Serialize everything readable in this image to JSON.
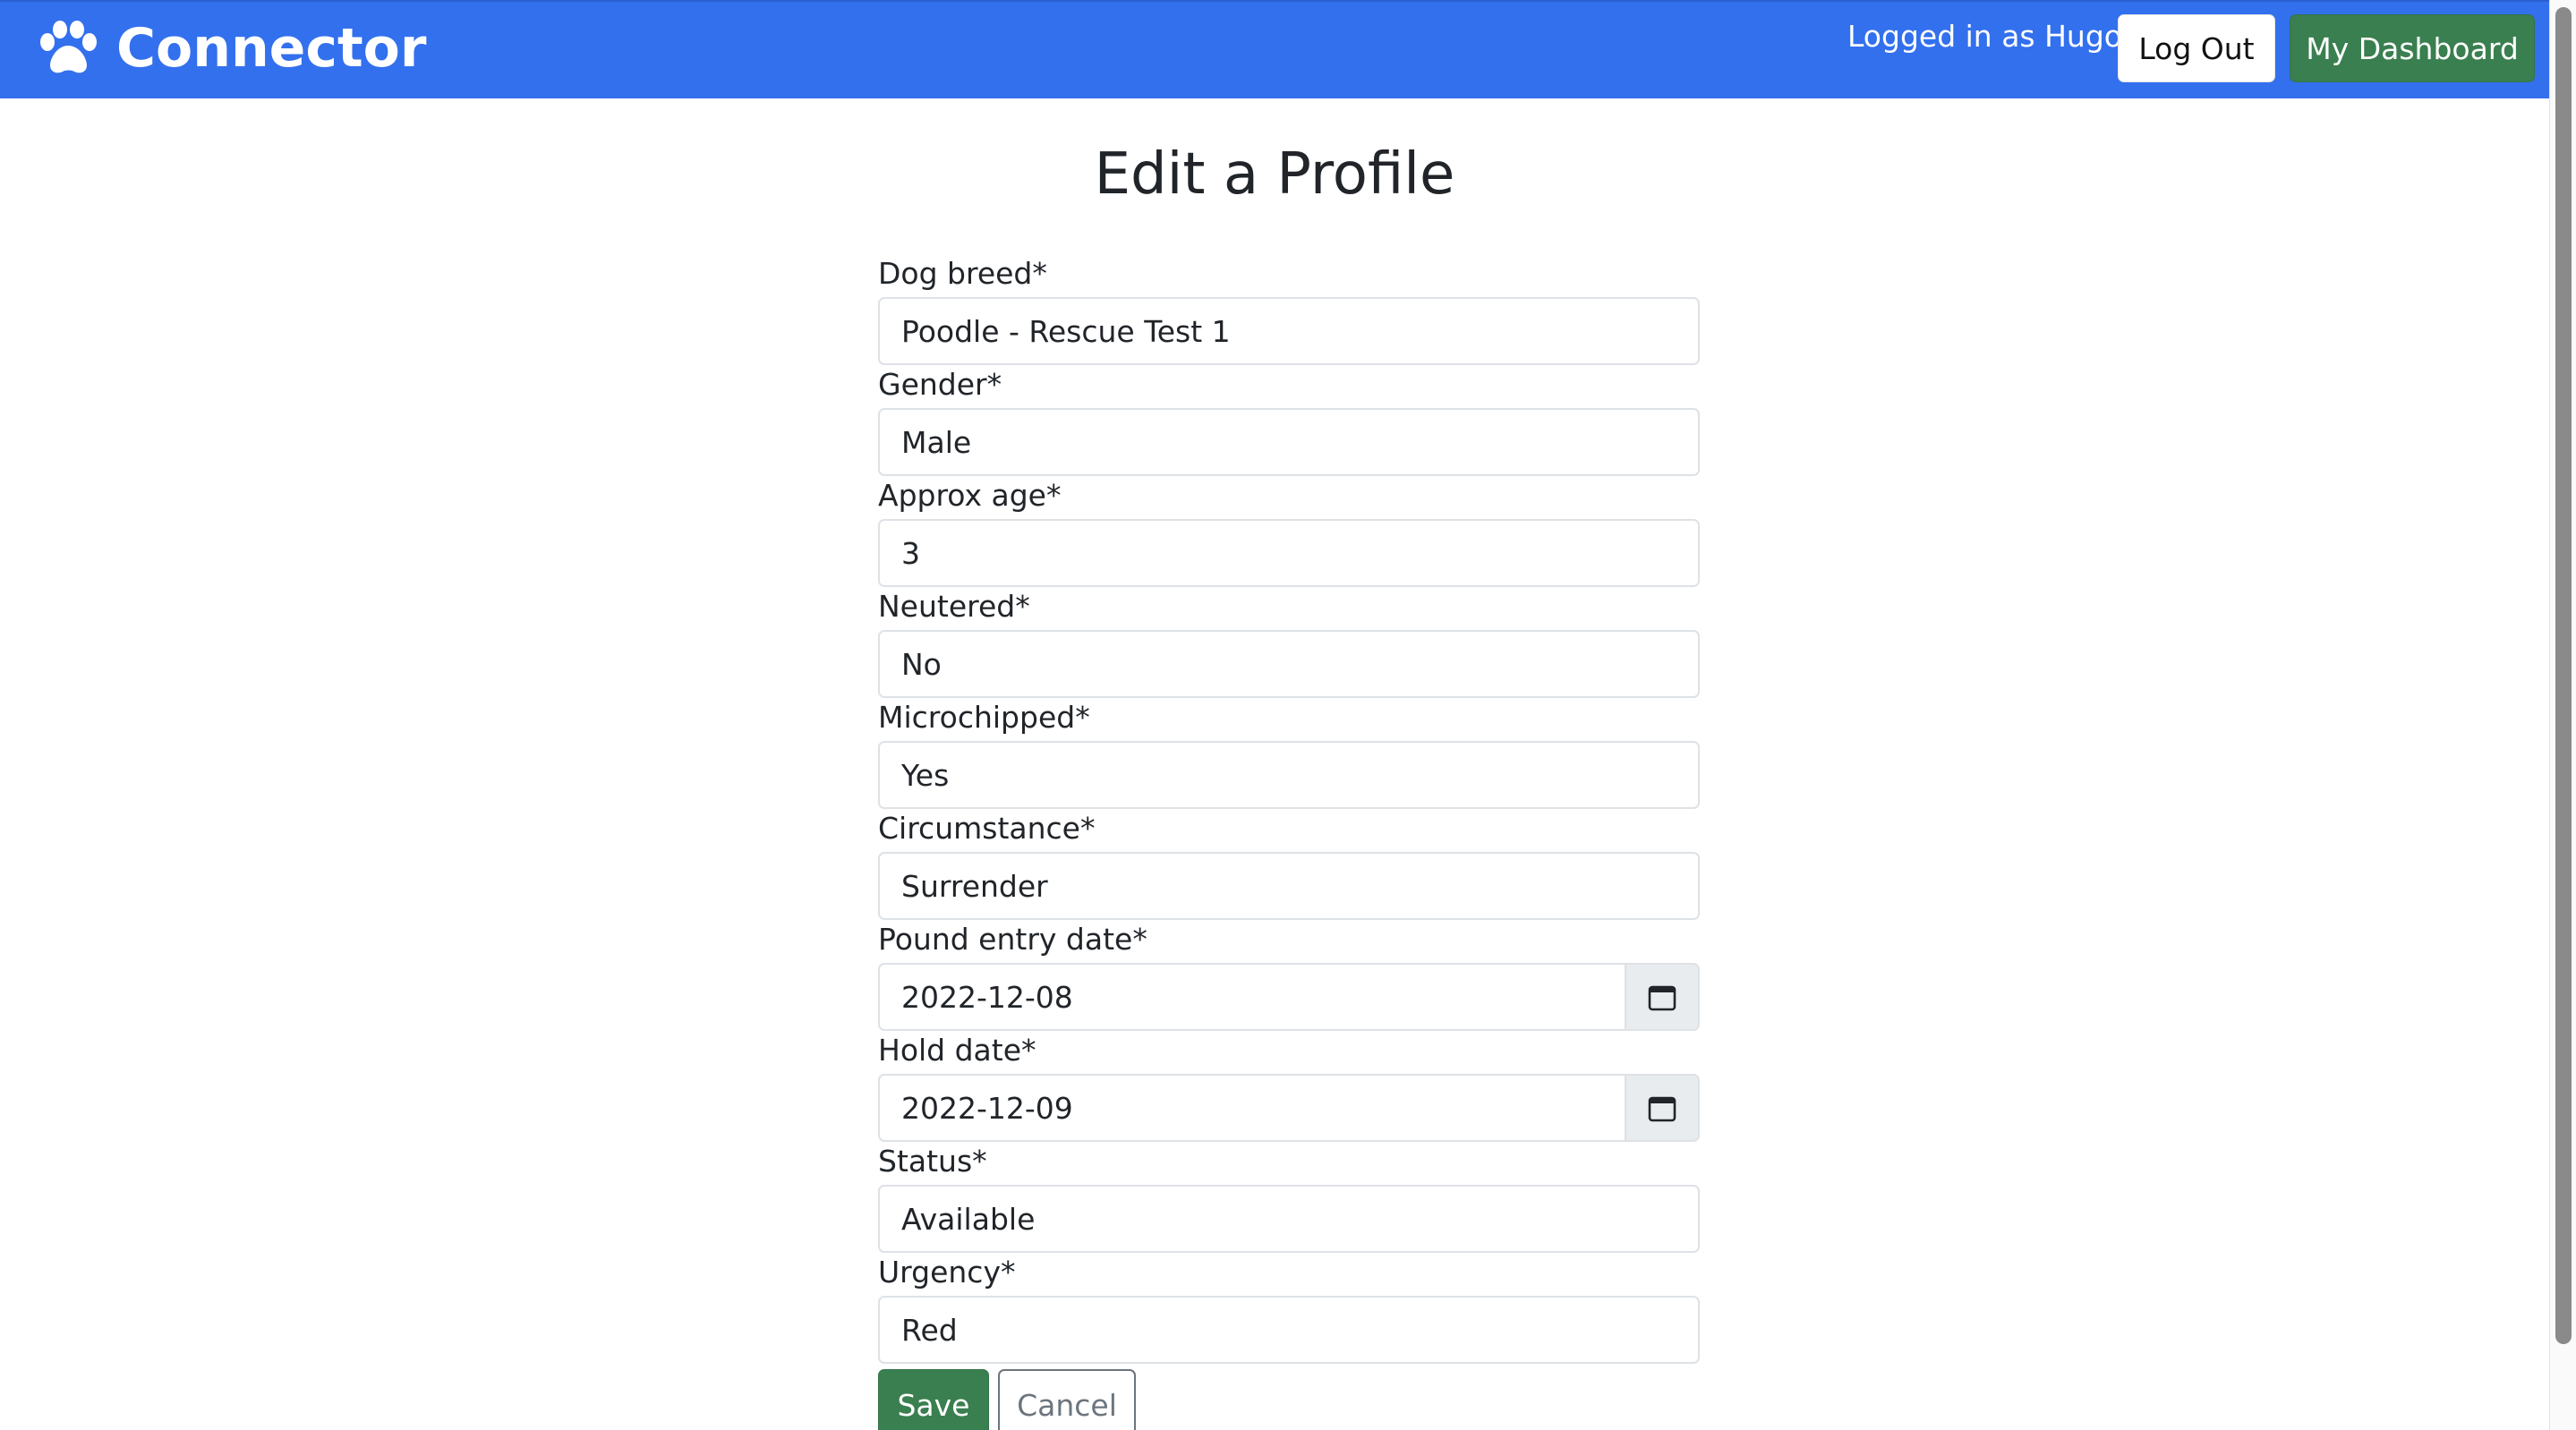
{
  "navbar": {
    "brand": "Connector",
    "brand_icon": "paw-icon",
    "logged_in_text": "Logged in as Hugo",
    "logout_label": "Log Out",
    "dashboard_label": "My Dashboard",
    "colors": {
      "navbar_bg": "#3370ee",
      "dashboard_bg": "#3a7f4f"
    }
  },
  "main": {
    "title": "Edit a Profile",
    "fields": [
      {
        "label": "Dog breed*",
        "value": "Poodle - Rescue Test 1"
      },
      {
        "label": "Gender*",
        "value": "Male"
      },
      {
        "label": "Approx age*",
        "value": "3"
      },
      {
        "label": "Neutered*",
        "value": "No"
      },
      {
        "label": "Microchipped*",
        "value": "Yes"
      },
      {
        "label": "Circumstance*",
        "value": "Surrender"
      },
      {
        "label": "Pound entry date*",
        "value": "2022-12-08",
        "icon": "calendar-icon"
      },
      {
        "label": "Hold date*",
        "value": "2022-12-09",
        "icon": "calendar-icon"
      },
      {
        "label": "Status*",
        "value": "Available"
      },
      {
        "label": "Urgency*",
        "value": "Red"
      }
    ],
    "save_label": "Save",
    "cancel_label": "Cancel"
  }
}
